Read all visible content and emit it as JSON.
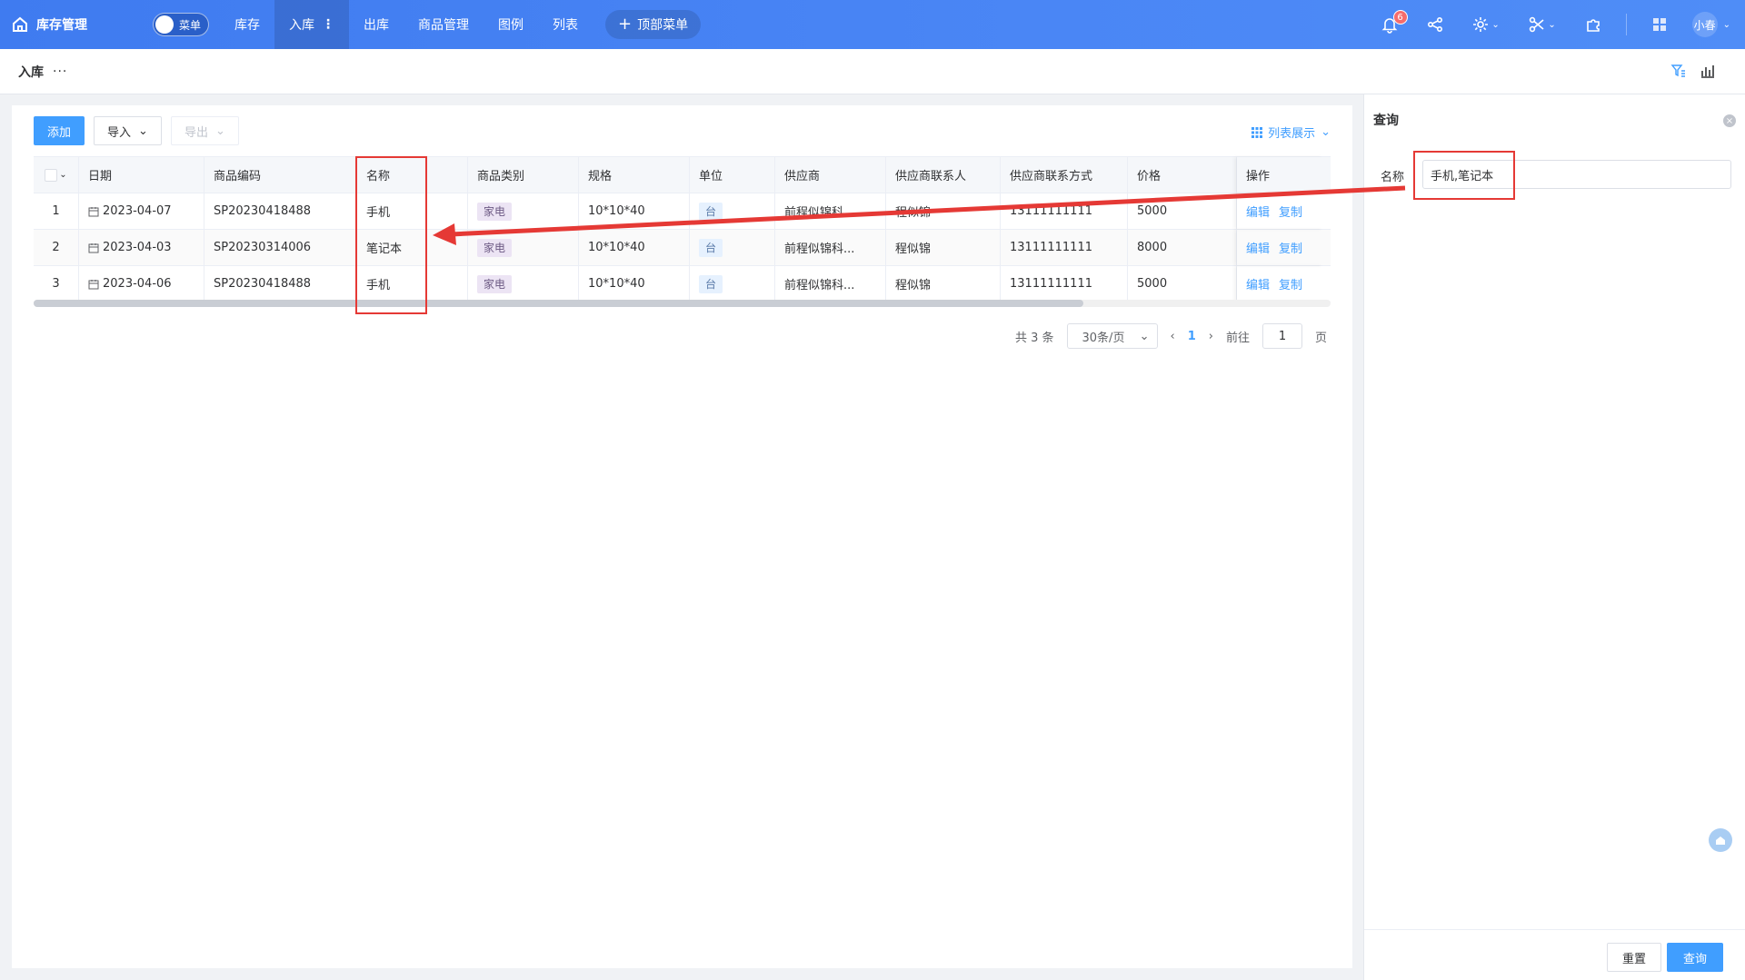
{
  "app": {
    "title": "库存管理"
  },
  "menu_toggle": {
    "label": "菜单"
  },
  "nav": [
    {
      "label": "库存",
      "active": false
    },
    {
      "label": "入库",
      "active": true
    },
    {
      "label": "出库",
      "active": false
    },
    {
      "label": "商品管理",
      "active": false
    },
    {
      "label": "图例",
      "active": false
    },
    {
      "label": "列表",
      "active": false
    }
  ],
  "top_menu_button": {
    "label": "顶部菜单"
  },
  "notifications": {
    "count": "6"
  },
  "user": {
    "name": "小春"
  },
  "breadcrumb": {
    "title": "入库",
    "more": "···"
  },
  "toolbar": {
    "add": "添加",
    "import": "导入",
    "export": "导出",
    "list_view": "列表展示"
  },
  "table": {
    "columns": [
      "日期",
      "商品编码",
      "名称",
      "商品类别",
      "规格",
      "单位",
      "供应商",
      "供应商联系人",
      "供应商联系方式",
      "价格",
      "操作"
    ],
    "rows": [
      {
        "index": "1",
        "date": "2023-04-07",
        "code": "SP20230418488",
        "name": "手机",
        "category": "家电",
        "spec": "10*10*40",
        "unit": "台",
        "supplier": "前程似锦科...",
        "contact": "程似锦",
        "phone": "13111111111",
        "price": "5000"
      },
      {
        "index": "2",
        "date": "2023-04-03",
        "code": "SP20230314006",
        "name": "笔记本",
        "category": "家电",
        "spec": "10*10*40",
        "unit": "台",
        "supplier": "前程似锦科...",
        "contact": "程似锦",
        "phone": "13111111111",
        "price": "8000"
      },
      {
        "index": "3",
        "date": "2023-04-06",
        "code": "SP20230418488",
        "name": "手机",
        "category": "家电",
        "spec": "10*10*40",
        "unit": "台",
        "supplier": "前程似锦科...",
        "contact": "程似锦",
        "phone": "13111111111",
        "price": "5000"
      }
    ],
    "actions": {
      "edit": "编辑",
      "copy": "复制"
    }
  },
  "pagination": {
    "total": "共 3 条",
    "page_size": "30条/页",
    "current": "1",
    "goto_label": "前往",
    "goto_value": "1",
    "page_suffix": "页"
  },
  "query_panel": {
    "title": "查询",
    "field_label": "名称",
    "field_value": "手机,笔记本",
    "reset": "重置",
    "submit": "查询"
  },
  "colors": {
    "topbar": "#4a86f5",
    "primary": "#409eff",
    "annotation": "#e53935"
  }
}
